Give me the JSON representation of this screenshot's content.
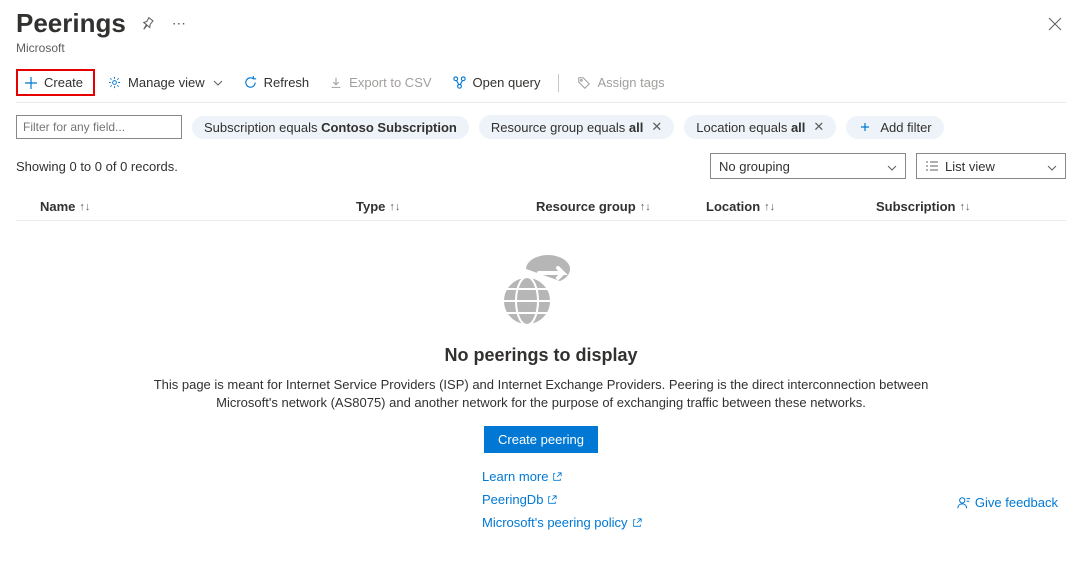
{
  "header": {
    "title": "Peerings",
    "subtitle": "Microsoft"
  },
  "toolbar": {
    "create": "Create",
    "manage_view": "Manage view",
    "refresh": "Refresh",
    "export_csv": "Export to CSV",
    "open_query": "Open query",
    "assign_tags": "Assign tags"
  },
  "filters": {
    "input_placeholder": "Filter for any field...",
    "subscription": {
      "prefix": "Subscription equals ",
      "value": "Contoso Subscription"
    },
    "resource_group": {
      "prefix": "Resource group equals ",
      "value": "all"
    },
    "location": {
      "prefix": "Location equals ",
      "value": "all"
    },
    "add_filter": "Add filter"
  },
  "records_text": "Showing 0 to 0 of 0 records.",
  "grouping_select": "No grouping",
  "view_select": "List view",
  "columns": {
    "name": "Name",
    "type": "Type",
    "resource_group": "Resource group",
    "location": "Location",
    "subscription": "Subscription"
  },
  "empty": {
    "title": "No peerings to display",
    "desc": "This page is meant for Internet Service Providers (ISP) and Internet Exchange Providers. Peering is the direct interconnection between Microsoft's network (AS8075) and another network for the purpose of exchanging traffic between these networks.",
    "button": "Create peering",
    "links": {
      "learn_more": "Learn more",
      "peeringdb": "PeeringDb",
      "policy": "Microsoft's peering policy"
    }
  },
  "feedback": "Give feedback"
}
